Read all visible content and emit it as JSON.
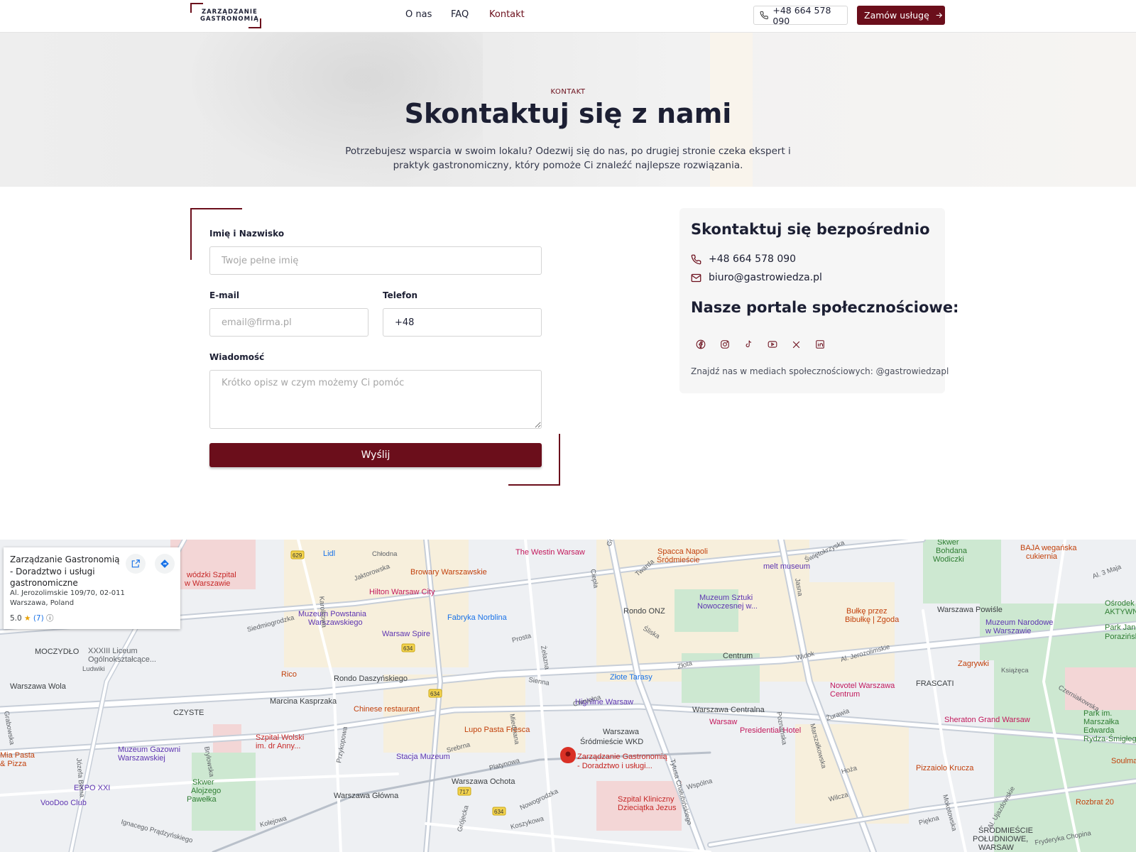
{
  "header": {
    "logo_line1": "ZARZĄDZANIE",
    "logo_line2": "GASTRONOMIĄ",
    "nav": [
      {
        "label": "O nas"
      },
      {
        "label": "FAQ"
      },
      {
        "label": "Kontakt",
        "active": true
      }
    ],
    "phone": "+48 664 578 090",
    "order_label": "Zamów usługę"
  },
  "hero": {
    "kicker": "KONTAKT",
    "title": "Skontaktuj się z nami",
    "subtitle": "Potrzebujesz wsparcia w swoim lokalu? Odezwij się do nas, po drugiej stronie czeka ekspert i praktyk gastronomiczny, który pomoże Ci znaleźć najlepsze rozwiązania."
  },
  "form": {
    "name_label": "Imię i Nazwisko",
    "name_placeholder": "Twoje pełne imię",
    "email_label": "E-mail",
    "email_placeholder": "email@firma.pl",
    "phone_label": "Telefon",
    "phone_value": "+48",
    "message_label": "Wiadomość",
    "message_placeholder": "Krótko opisz w czym możemy Ci pomóc",
    "submit_label": "Wyślij"
  },
  "contact_card": {
    "title": "Skontaktuj się bezpośrednio",
    "phone": "+48 664 578 090",
    "email": "biuro@gastrowiedza.pl",
    "social_title": "Nasze portale społecznościowe:",
    "social_icons": [
      "facebook-icon",
      "instagram-icon",
      "tiktok-icon",
      "youtube-icon",
      "x-icon",
      "linkedin-icon"
    ],
    "note": "Znajdź nas w mediach społecznościowych: @gastrowiedzapl"
  },
  "map": {
    "place_name": "Zarządzanie Gastronomią - Doradztwo i usługi gastronomiczne",
    "address_line1": "Al. Jerozolimskie 109/70, 02-011",
    "address_line2": "Warszawa, Poland",
    "rating": "5.0",
    "review_count": "(7)",
    "pin_label_line1": "Zarządzanie Gastronomią",
    "pin_label_line2": "- Doradztwo i usługi...",
    "labels": [
      {
        "text": "Lidl",
        "color": "#1a73e8"
      },
      {
        "text": "The Westin Warsaw",
        "color": "#c2185b"
      },
      {
        "text": "Spacca Napoli",
        "color": "#c2410c"
      },
      {
        "text": "Śródmieście",
        "color": "#c2410c"
      },
      {
        "text": "melt museum",
        "color": "#5e35b1"
      },
      {
        "text": "Skwer",
        "color": "#2e7d32"
      },
      {
        "text": "Bohdana",
        "color": "#2e7d32"
      },
      {
        "text": "Wodiczki",
        "color": "#2e7d32"
      },
      {
        "text": "BAJA wegańska",
        "color": "#c2410c"
      },
      {
        "text": "cukiernia",
        "color": "#c2410c"
      },
      {
        "text": "Browary Warszawskie",
        "color": "#c2410c"
      },
      {
        "text": "Hilton Warsaw City",
        "color": "#c2185b"
      },
      {
        "text": "Muzeum Powstania",
        "color": "#5e35b1"
      },
      {
        "text": "Warszawskiego",
        "color": "#5e35b1"
      },
      {
        "text": "Fabryka Norblina",
        "color": "#1a73e8"
      },
      {
        "text": "Rondo ONZ",
        "color": "#3c4043"
      },
      {
        "text": "Muzeum Sztuki",
        "color": "#5e35b1"
      },
      {
        "text": "Nowoczesnej w...",
        "color": "#5e35b1"
      },
      {
        "text": "Bułkę przez",
        "color": "#c2410c"
      },
      {
        "text": "Bibułkę | Zgoda",
        "color": "#c2410c"
      },
      {
        "text": "Warszawa Powiśle",
        "color": "#3c4043"
      },
      {
        "text": "Muzeum Narodowe",
        "color": "#5e35b1"
      },
      {
        "text": "w Warszawie",
        "color": "#5e35b1"
      },
      {
        "text": "Ośrodek Solec",
        "color": "#2e7d32"
      },
      {
        "text": "AKTYWNA...",
        "color": "#2e7d32"
      },
      {
        "text": "Warsaw Spire",
        "color": "#5e35b1"
      },
      {
        "text": "MOCZYDŁO",
        "color": "#3c4043"
      },
      {
        "text": "XXXIII Liceum",
        "color": "#5f6368"
      },
      {
        "text": "Ogólnokształcące...",
        "color": "#5f6368"
      },
      {
        "text": "Centrum",
        "color": "#3c4043"
      },
      {
        "text": "Zagrywki",
        "color": "#c2410c"
      },
      {
        "text": "Park Janiny",
        "color": "#2e7d32"
      },
      {
        "text": "Porazińskiej",
        "color": "#2e7d32"
      },
      {
        "text": "Rico",
        "color": "#c2410c"
      },
      {
        "text": "Rondo Daszyńskiego",
        "color": "#3c4043"
      },
      {
        "text": "Złote Tarasy",
        "color": "#1a73e8"
      },
      {
        "text": "FRASCATI",
        "color": "#3c4043"
      },
      {
        "text": "Novotel Warszawa",
        "color": "#c2185b"
      },
      {
        "text": "Centrum",
        "color": "#c2185b"
      },
      {
        "text": "Warszawa Wola",
        "color": "#3c4043"
      },
      {
        "text": "Marcina Kasprzaka",
        "color": "#3c4043"
      },
      {
        "text": "CZYSTE",
        "color": "#3c4043"
      },
      {
        "text": "Chinese restaurant",
        "color": "#c2410c"
      },
      {
        "text": "Highline Warsaw",
        "color": "#5e35b1"
      },
      {
        "text": "Warszawa Centralna",
        "color": "#3c4043"
      },
      {
        "text": "Warsaw",
        "color": "#c2185b"
      },
      {
        "text": "Presidential Hotel",
        "color": "#c2185b"
      },
      {
        "text": "Sheraton Grand Warsaw",
        "color": "#c2185b"
      },
      {
        "text": "Park im.",
        "color": "#2e7d32"
      },
      {
        "text": "Marszałka",
        "color": "#2e7d32"
      },
      {
        "text": "Edwarda",
        "color": "#2e7d32"
      },
      {
        "text": "Rydza-Śmigłego",
        "color": "#2e7d32"
      },
      {
        "text": "Lupo Pasta Fresca",
        "color": "#c2410c"
      },
      {
        "text": "Warszawa",
        "color": "#3c4043"
      },
      {
        "text": "Śródmieście WKD",
        "color": "#3c4043"
      },
      {
        "text": "Szpital Wolski",
        "color": "#c62828"
      },
      {
        "text": "im. dr Anny...",
        "color": "#c62828"
      },
      {
        "text": "Muzeum Gazowni",
        "color": "#5e35b1"
      },
      {
        "text": "Warszawskiej",
        "color": "#5e35b1"
      },
      {
        "text": "Stacja Muzeum",
        "color": "#5e35b1"
      },
      {
        "text": "Pizzaiolo Krucza",
        "color": "#c2410c"
      },
      {
        "text": "Soulmates",
        "color": "#c2410c"
      },
      {
        "text": "Mia Pasta",
        "color": "#c2410c"
      },
      {
        "text": "& Pizza",
        "color": "#c2410c"
      },
      {
        "text": "EXPO XXI",
        "color": "#5e35b1"
      },
      {
        "text": "Warszawa Ochota",
        "color": "#3c4043"
      },
      {
        "text": "Skwer",
        "color": "#2e7d32"
      },
      {
        "text": "Alojzego",
        "color": "#2e7d32"
      },
      {
        "text": "Pawełka",
        "color": "#2e7d32"
      },
      {
        "text": "VooDoo Club",
        "color": "#5e35b1"
      },
      {
        "text": "Warszawa Główna",
        "color": "#3c4043"
      },
      {
        "text": "Szpital Kliniczny",
        "color": "#c62828"
      },
      {
        "text": "Dzieciątka Jezus",
        "color": "#c62828"
      },
      {
        "text": "Rozbrat 20",
        "color": "#c2410c"
      },
      {
        "text": "ŚRÓDMIEŚCIE",
        "color": "#3c4043"
      },
      {
        "text": "POŁUDNIOWE,",
        "color": "#3c4043"
      },
      {
        "text": "WARSAW",
        "color": "#3c4043"
      },
      {
        "text": "wódzki Szpital",
        "color": "#c62828"
      },
      {
        "text": "w Warszawie",
        "color": "#c62828"
      }
    ],
    "streets": [
      "Grzybowska",
      "Świętokrzyska",
      "Chłodna",
      "Jaktorowska",
      "Karolkowa",
      "Ciepła",
      "Twarda",
      "Prosta",
      "Żelazna",
      "Śliska",
      "Siedmiogrodzka",
      "Ludwiki",
      "Sienna",
      "Złota",
      "Widok",
      "Al. Jerozolimskie",
      "Książęca",
      "Czerniakowska",
      "Chmielna",
      "Marszałkowska",
      "Poznańska",
      "Żurawia",
      "Tytusa Chałubińskiego",
      "Kolejowa",
      "Ignacego Prądzyńskiego",
      "Wspólna",
      "Hoża",
      "Wilcza",
      "Koszykowa",
      "Nowogrodzka",
      "Grójecka",
      "Piękna",
      "Al. Ujazdowskie",
      "Mokotowska",
      "Fryderyka Chopina",
      "Al. 3 Maja",
      "Jasna",
      "Józefa Bema",
      "Brylowska",
      "Przykopowa",
      "Srebrna",
      "Platynowa",
      "Miedziana",
      "Grabowska"
    ],
    "road_numbers": [
      "629",
      "629",
      "634",
      "634",
      "717",
      "634"
    ]
  }
}
